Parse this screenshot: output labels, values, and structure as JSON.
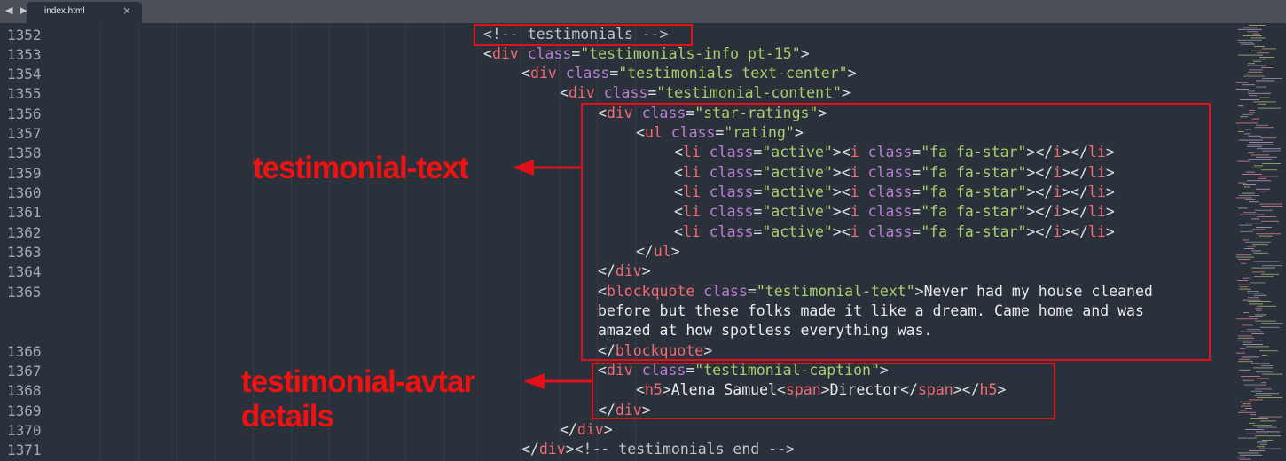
{
  "editor_tab": {
    "filename": "index.html",
    "close_glyph": "×",
    "nav_glyph": "◀ ▶"
  },
  "line_numbers": [
    "1352",
    "1353",
    "1354",
    "1355",
    "1356",
    "1357",
    "1358",
    "1359",
    "1360",
    "1361",
    "1362",
    "1363",
    "1364",
    "1365",
    "1366",
    "1367",
    "1368",
    "1369",
    "1370",
    "1371"
  ],
  "code": {
    "l1352": "<!-- testimonials -->",
    "l1353": {
      "open": "<",
      "tag": "div",
      "attr": "class",
      "val": "\"testimonials-info pt-15\"",
      "close": ">"
    },
    "l1354": {
      "open": "<",
      "tag": "div",
      "attr": "class",
      "val": "\"testimonials text-center\"",
      "close": ">"
    },
    "l1355": {
      "open": "<",
      "tag": "div",
      "attr": "class",
      "val": "\"testimonial-content\"",
      "close": ">"
    },
    "l1356": {
      "open": "<",
      "tag": "div",
      "attr": "class",
      "val": "\"star-ratings\"",
      "close": ">"
    },
    "l1357": {
      "open": "<",
      "tag": "ul",
      "attr": "class",
      "val": "\"rating\"",
      "close": ">"
    },
    "star_line": {
      "open": "<",
      "li": "li",
      "attr": "class",
      "li_val": "\"active\"",
      "gt": ">",
      "lt": "<",
      "i": "i",
      "i_val": "\"fa fa-star\"",
      "close_i": "</",
      "close_li": "></",
      "end": ">"
    },
    "l1363": {
      "open": "</",
      "tag": "ul",
      "close": ">"
    },
    "l1364": {
      "open": "</",
      "tag": "div",
      "close": ">"
    },
    "l1365": {
      "open": "<",
      "tag": "blockquote",
      "attr": "class",
      "val": "\"testimonial-text\"",
      "close": ">",
      "text1": "Never had my house cleaned",
      "text2": "before but these folks made it like a dream. Came home and was",
      "text3": "amazed at how spotless everything was."
    },
    "l1366": {
      "open": "</",
      "tag": "blockquote",
      "close": ">"
    },
    "l1367": {
      "open": "<",
      "tag": "div",
      "attr": "class",
      "val": "\"testimonial-caption\"",
      "close": ">"
    },
    "l1368": {
      "open": "<",
      "tag": "h5",
      "close": ">",
      "name": "Alena Samuel",
      "span": "span",
      "title": "Director",
      "close_span_open": "</",
      "close_h5": "h5"
    },
    "l1369": {
      "open": "</",
      "tag": "div",
      "close": ">"
    },
    "l1370": {
      "open": "</",
      "tag": "div",
      "close": ">"
    },
    "l1371": {
      "open": "</",
      "tag": "div",
      "close": ">",
      "comment": "<!-- testimonials end -->"
    }
  },
  "annotations": {
    "text_label": "testimonial-text",
    "avatar_label_1": "testimonial-avtar",
    "avatar_label_2": "details"
  },
  "colors": {
    "background": "#2b313b",
    "tag": "#f16a74",
    "attribute": "#b77ed3",
    "string": "#a9cf6e",
    "annotation": "#f01111"
  }
}
